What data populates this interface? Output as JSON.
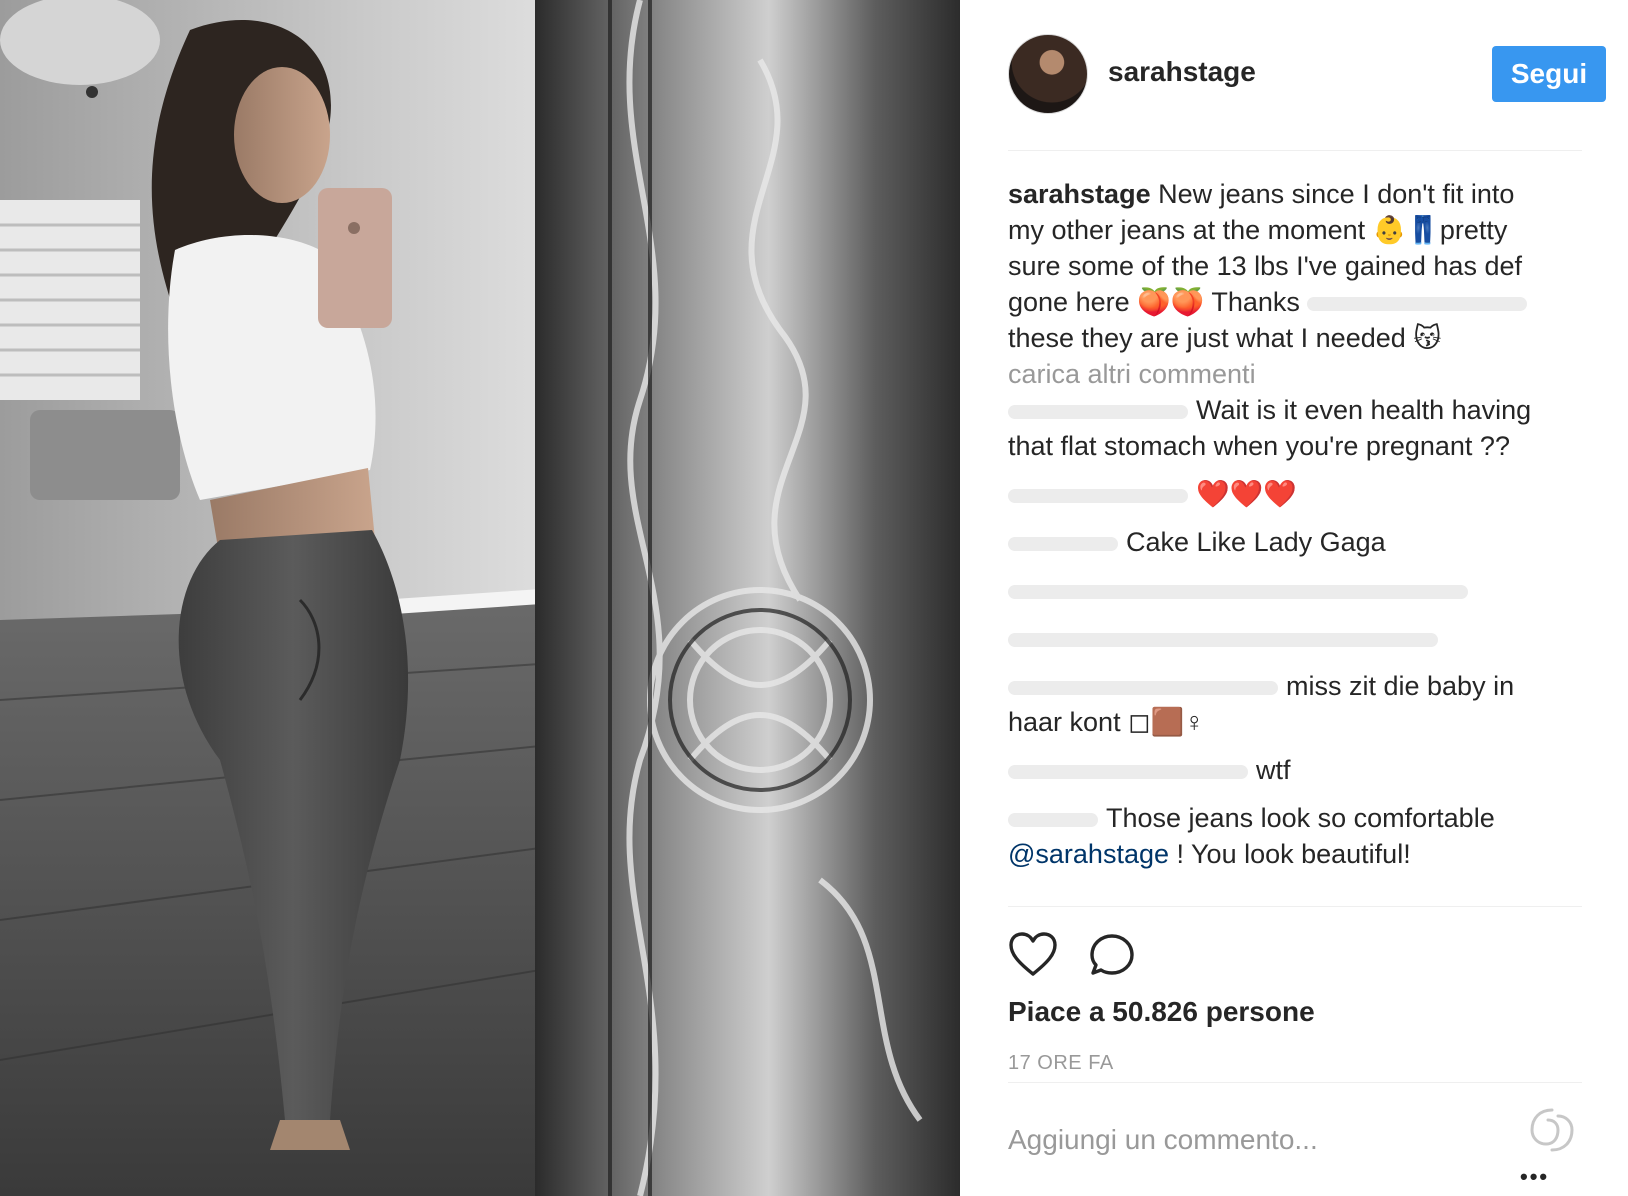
{
  "post": {
    "username": "sarahstage",
    "follow_label": "Segui",
    "caption": {
      "user": "sarahstage",
      "line1": "New jeans since I don't fit into",
      "line2": "my other jeans at the moment 👶👖pretty",
      "line3": "sure some of the 13 lbs I've gained has def",
      "line4": "gone here 🍑🍑 Thanks",
      "line5": "these they are just what I needed 😽"
    },
    "load_more": "carica altri commenti",
    "comments": [
      {
        "text1": "Wait is it even health having",
        "text2": "that flat stomach when you're pregnant ??"
      },
      {
        "text1": "❤️❤️❤️"
      },
      {
        "text1": "Cake Like Lady Gaga"
      },
      {
        "text1": "miss zit die baby in",
        "text2": "haar kont ◻🟫♀"
      },
      {
        "text1": "wtf"
      },
      {
        "text1": "Those jeans look so comfortable",
        "mention": "@sarahstage",
        "text2": " ! You look beautiful!"
      }
    ],
    "likes": "Piace a 50.826 persone",
    "time": "17 ORE FA",
    "add_comment_placeholder": "Aggiungi un commento...",
    "more_label": "•••"
  },
  "icons": [
    "heart-icon",
    "comment-icon",
    "loading-icon",
    "more-options-icon"
  ],
  "colors": {
    "follow_button": "#3897f0",
    "secondary_text": "#999999",
    "mention": "#003569"
  }
}
